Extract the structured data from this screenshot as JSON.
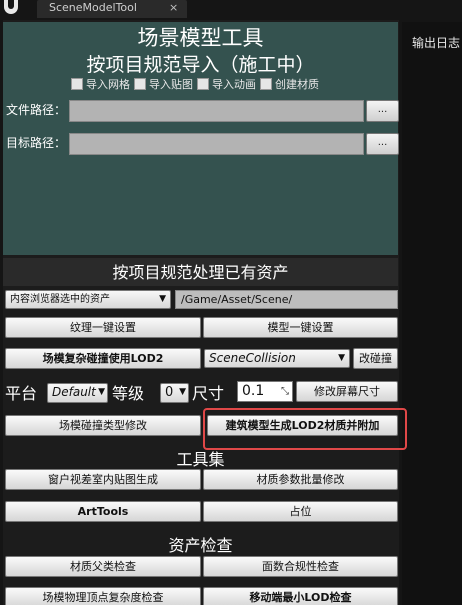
{
  "window": {
    "tab_title": "SceneModelTool",
    "tab_close": "×",
    "log_title": "输出日志"
  },
  "import_section": {
    "title": "场景模型工具",
    "subtitle": "按项目规范导入（施工中）",
    "checkboxes": [
      {
        "label": "导入网格",
        "checked": false
      },
      {
        "label": "导入贴图",
        "checked": false
      },
      {
        "label": "导入动画",
        "checked": false
      },
      {
        "label": "创建材质",
        "checked": false
      }
    ],
    "file_path_label": "文件路径：",
    "file_path_value": "",
    "target_path_label": "目标路径：",
    "target_path_value": "",
    "browse_label": "..."
  },
  "process_section": {
    "title": "按项目规范处理已有资产",
    "source_select": "内容浏览器选中的资产",
    "path_value": "/Game/Asset/Scene/",
    "texture_setup": "纹理一键设置",
    "model_setup": "模型一键设置",
    "complex_collision": "场模复杂碰撞使用LOD2",
    "collision_select": "SceneCollision",
    "modify_collision": "改碰撞",
    "platform_label": "平台",
    "platform_value": "Default",
    "level_label": "等级",
    "level_value": "0",
    "size_label": "尺寸",
    "size_value": "0.1",
    "modify_screen_size": "修改屏幕尺寸",
    "collision_type_modify": "场模碰撞类型修改",
    "building_lod2": "建筑模型生成LOD2材质并附加"
  },
  "tools_section": {
    "title": "工具集",
    "window_parallax": "窗户视差室内贴图生成",
    "material_batch": "材质参数批量修改",
    "art_tools": "ArtTools",
    "placeholder": "占位"
  },
  "check_section": {
    "title": "资产检查",
    "material_parent": "材质父类检查",
    "face_count": "面数合规性检查",
    "physics_vertex": "场模物理顶点复杂度检查",
    "mobile_lod": "移动端最小LOD检查"
  }
}
